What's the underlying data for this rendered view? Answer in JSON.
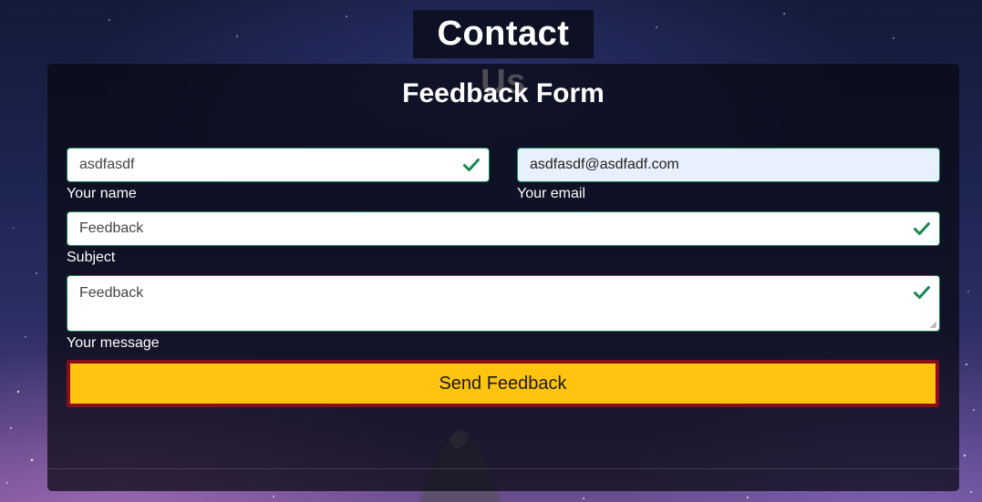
{
  "page": {
    "title": "Contact Us"
  },
  "form": {
    "title": "Feedback Form",
    "name": {
      "value": "asdfasdf",
      "label": "Your name"
    },
    "email": {
      "value": "asdfasdf@asdfadf.com",
      "label": "Your email"
    },
    "subject": {
      "value": "Feedback",
      "label": "Subject"
    },
    "message": {
      "value": "Feedback",
      "label": "Your message"
    },
    "submit_label": "Send Feedback"
  },
  "icons": {
    "valid": "check-icon"
  },
  "colors": {
    "valid_green": "#198754",
    "button_bg": "#ffc40f",
    "button_border": "#8a0e1a",
    "autofill_bg": "#e8f0fe"
  }
}
